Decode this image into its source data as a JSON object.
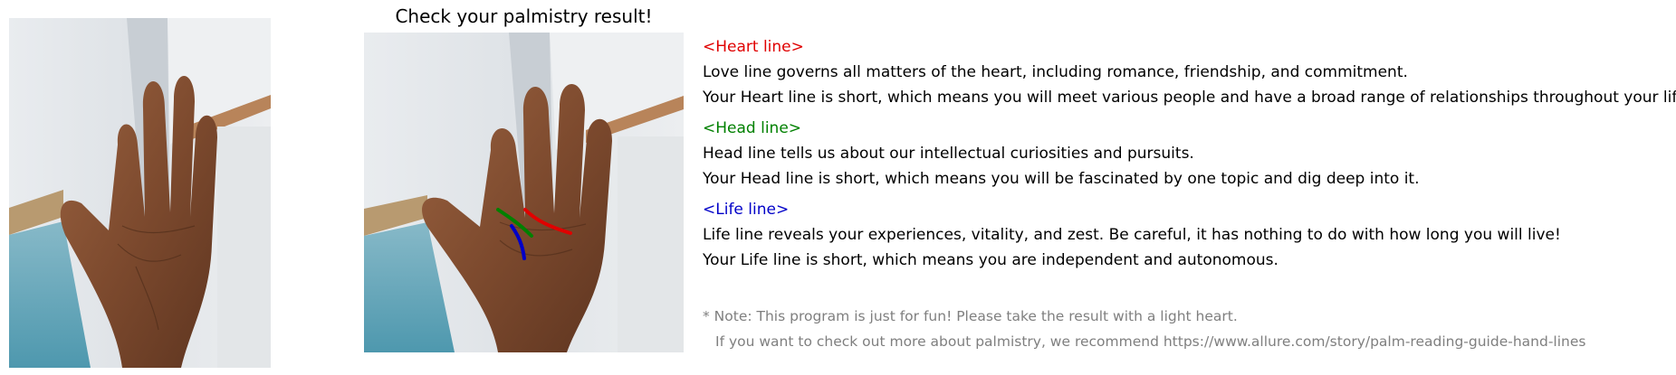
{
  "result_title": "Check your palmistry result!",
  "images": {
    "original": {
      "icon": "palm-photo-original"
    },
    "result": {
      "icon": "palm-photo-with-detected-lines"
    }
  },
  "sections": [
    {
      "key": "heart",
      "heading": "<Heart line>",
      "color": "#e00000",
      "description": "Love line governs all matters of the heart, including romance, friendship, and commitment.",
      "result": "Your Heart line is short, which means you will meet various people and have a broad range of relationships throughout your life."
    },
    {
      "key": "head",
      "heading": "<Head line>",
      "color": "#008000",
      "description": "Head line tells us about our intellectual curiosities and pursuits.",
      "result": "Your Head line is short, which means you will be fascinated by one topic and dig deep into it."
    },
    {
      "key": "life",
      "heading": "<Life line>",
      "color": "#0000c8",
      "description": "Life line reveals your experiences, vitality, and zest. Be careful, it has nothing to do with how long you will live!",
      "result": "Your Life line is short, which means you are independent and autonomous."
    }
  ],
  "note": {
    "line1": "* Note: This program is just for fun! Please take the result with a light heart.",
    "line2": "If you want to check out more about palmistry, we recommend https://www.allure.com/story/palm-reading-guide-hand-lines",
    "color": "#7f7f7f"
  }
}
